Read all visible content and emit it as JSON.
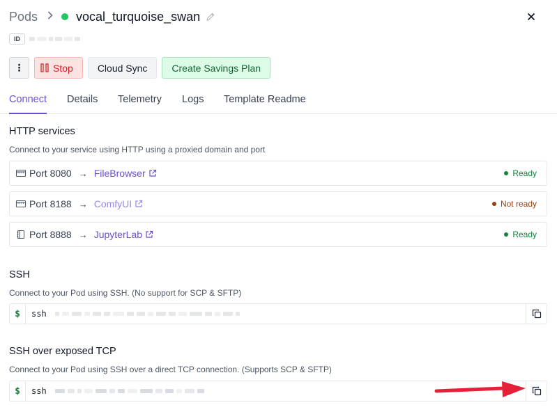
{
  "header": {
    "breadcrumb_root": "Pods",
    "breadcrumb_sep": ">",
    "pod_name": "vocal_turquoise_swan",
    "status_color": "#22c55e",
    "close_icon": "close-icon",
    "edit_icon": "pencil-icon"
  },
  "id_row": {
    "badge": "ID"
  },
  "toolbar": {
    "more_label": "⋮",
    "stop_label": "Stop",
    "cloud_sync_label": "Cloud Sync",
    "savings_label": "Create Savings Plan"
  },
  "tabs": [
    {
      "label": "Connect",
      "active": true
    },
    {
      "label": "Details",
      "active": false
    },
    {
      "label": "Telemetry",
      "active": false
    },
    {
      "label": "Logs",
      "active": false
    },
    {
      "label": "Template Readme",
      "active": false
    }
  ],
  "http": {
    "title": "HTTP services",
    "description": "Connect to your service using HTTP using a proxied domain and port",
    "services": [
      {
        "port": "Port 8080",
        "arrow": "→",
        "name": "FileBrowser",
        "status": "Ready",
        "icon": "window-icon"
      },
      {
        "port": "Port 8188",
        "arrow": "→",
        "name": "ComfyUI",
        "status": "Not ready",
        "icon": "window-icon"
      },
      {
        "port": "Port 8888",
        "arrow": "→",
        "name": "JupyterLab",
        "status": "Ready",
        "icon": "notebook-icon"
      }
    ]
  },
  "ssh": {
    "title": "SSH",
    "description": "Connect to your Pod using SSH. (No support for SCP & SFTP)",
    "prompt": "$",
    "command": "ssh"
  },
  "ssh_tcp": {
    "title": "SSH over exposed TCP",
    "description": "Connect to your Pod using SSH over a direct TCP connection. (Supports SCP & SFTP)",
    "prompt": "$",
    "command": "ssh"
  },
  "colors": {
    "accent": "#6d4fd3",
    "ready": "#15803d",
    "not_ready": "#92400e",
    "stop": "#c81e1e",
    "annotation_arrow": "#e5213a"
  }
}
